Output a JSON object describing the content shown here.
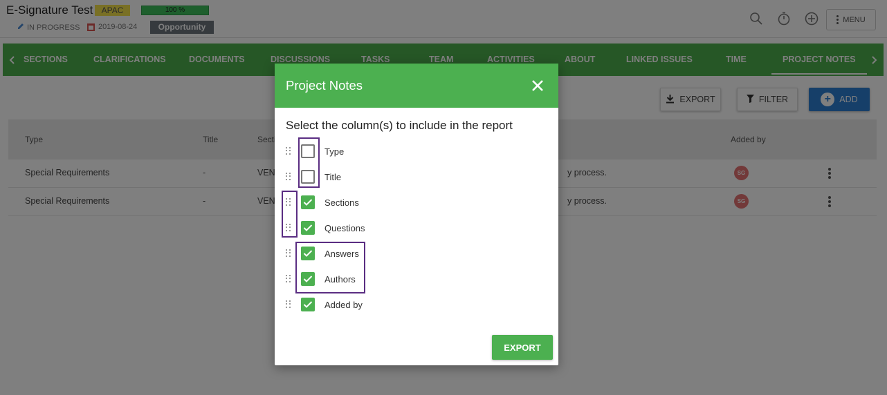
{
  "header": {
    "title": "E-Signature Test",
    "region": "APAC",
    "progress_label": "100 %",
    "progress_value": 100,
    "status": "IN PROGRESS",
    "date": "2019-08-24",
    "opportunity": "Opportunity",
    "menu_label": "MENU"
  },
  "tabs": [
    {
      "label": "SECTIONS"
    },
    {
      "label": "CLARIFICATIONS"
    },
    {
      "label": "DOCUMENTS"
    },
    {
      "label": "DISCUSSIONS"
    },
    {
      "label": "TASKS"
    },
    {
      "label": "TEAM"
    },
    {
      "label": "ACTIVITIES"
    },
    {
      "label": "ABOUT"
    },
    {
      "label": "LINKED ISSUES"
    },
    {
      "label": "TIME"
    },
    {
      "label": "PROJECT NOTES"
    }
  ],
  "toolbar": {
    "export_label": "EXPORT",
    "filter_label": "FILTER",
    "add_label": "ADD"
  },
  "table": {
    "headers": [
      "Type",
      "Title",
      "Secti",
      "Added by"
    ],
    "rows": [
      {
        "type": "Special Requirements",
        "title": "-",
        "section": "VEND",
        "note": "y process.",
        "avatar": "SG"
      },
      {
        "type": "Special Requirements",
        "title": "-",
        "section": "VEND",
        "note": "y process.",
        "avatar": "SG"
      }
    ]
  },
  "modal": {
    "title": "Project Notes",
    "subtitle": "Select the column(s) to include in the report",
    "options": [
      {
        "label": "Type",
        "checked": false
      },
      {
        "label": "Title",
        "checked": false
      },
      {
        "label": "Sections",
        "checked": true
      },
      {
        "label": "Questions",
        "checked": true
      },
      {
        "label": "Answers",
        "checked": true
      },
      {
        "label": "Authors",
        "checked": true
      },
      {
        "label": "Added by",
        "checked": true
      }
    ],
    "export_label": "EXPORT"
  },
  "colors": {
    "green": "#4cb050",
    "blue": "#2d7fd3",
    "highlight": "#5a2d82"
  }
}
